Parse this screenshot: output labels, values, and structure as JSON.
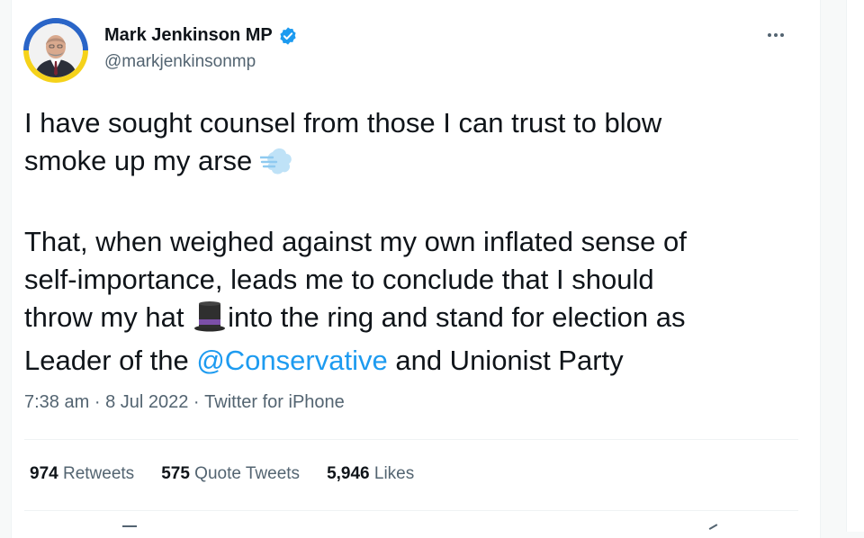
{
  "tweet": {
    "author": {
      "display_name": "Mark Jenkinson MP",
      "handle": "@markjenkinsonmp",
      "verified": true,
      "avatar_ring_colors": [
        "#2a65c7",
        "#f5d21a"
      ]
    },
    "text": {
      "line1_a": "I have sought counsel from those I can trust to blow",
      "line1_b": "smoke up my arse",
      "line2_a": "That, when weighed against my own inflated sense of",
      "line2_b": "self-importance, leads me to conclude that I should",
      "line2_c_before": "throw my hat",
      "line2_c_after": "into the ring and stand for election as",
      "line2_d_before": "Leader of the",
      "mention": "@Conservative",
      "line2_d_after": "and Unionist Party",
      "emoji_1": "dashing-away-emoji",
      "emoji_2": "top-hat-emoji"
    },
    "time": "7:38 am",
    "date": "8 Jul 2022",
    "source": "Twitter for iPhone",
    "separator": "·",
    "stats": {
      "retweets_count": "974",
      "retweets_label": "Retweets",
      "quotes_count": "575",
      "quotes_label": "Quote Tweets",
      "likes_count": "5,946",
      "likes_label": "Likes"
    }
  },
  "colors": {
    "link": "#1d9bf0",
    "text": "#0f1419",
    "secondary": "#536471",
    "verified": "#1d9bf0"
  },
  "icons": {
    "more": "more-horizontal-icon",
    "verified": "verified-badge-icon"
  }
}
